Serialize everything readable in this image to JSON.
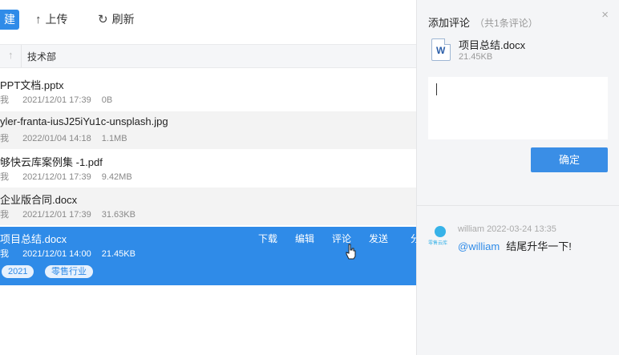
{
  "toolbar": {
    "new_label": "建",
    "upload_label": "上传",
    "refresh_label": "刷新"
  },
  "path": {
    "current": "技术部"
  },
  "files": [
    {
      "name": "PPT文档.pptx",
      "owner": "我",
      "date": "2021/12/01 17:39",
      "size": "0B"
    },
    {
      "name": "yler-franta-iusJ25iYu1c-unsplash.jpg",
      "owner": "我",
      "date": "2022/01/04 14:18",
      "size": "1.1MB"
    },
    {
      "name": "够快云库案例集 -1.pdf",
      "owner": "我",
      "date": "2021/12/01 17:39",
      "size": "9.42MB"
    },
    {
      "name": "企业版合同.docx",
      "owner": "我",
      "date": "2021/12/01 17:39",
      "size": "31.63KB"
    }
  ],
  "selected": {
    "name": "项目总结.docx",
    "owner": "我",
    "date": "2021/12/01 14:00",
    "size": "21.45KB",
    "actions": [
      "下载",
      "编辑",
      "评论",
      "发送",
      "分"
    ],
    "tags": [
      "2021",
      "零售行业"
    ]
  },
  "comments_panel": {
    "title": "添加评论",
    "count": "（共1条评论）",
    "close": "×",
    "file_icon_letter": "W",
    "file_name": "项目总结.docx",
    "file_size": "21.45KB",
    "confirm_label": "确定",
    "comment": {
      "avatar_text": "零售云库",
      "author": "william",
      "time": "2022-03-24 13:35",
      "mention": "@william",
      "text": "结尾升华一下!"
    }
  }
}
